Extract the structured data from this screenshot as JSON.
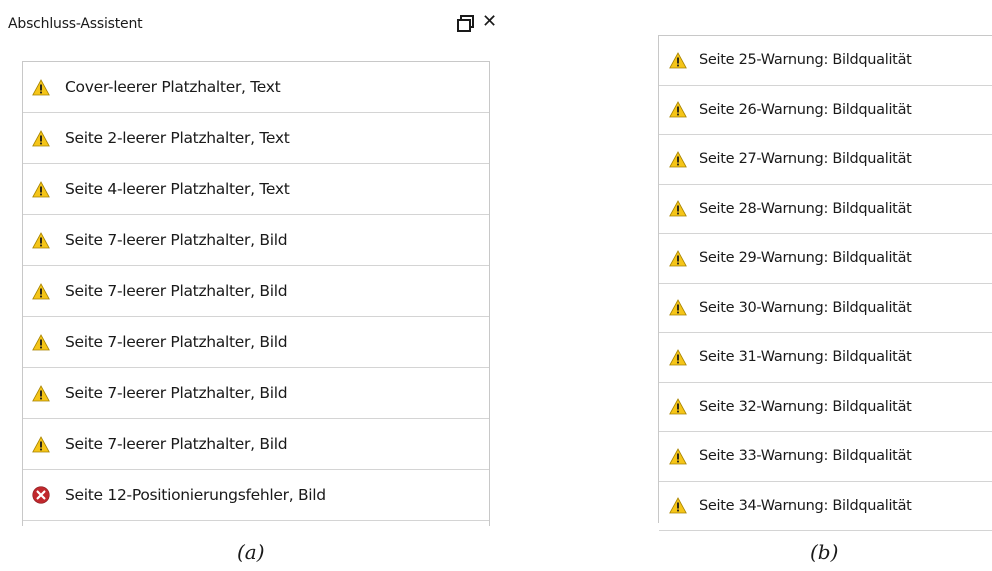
{
  "panel_a": {
    "title": "Abschluss-Assistent",
    "close_glyph": "✕",
    "items": [
      {
        "icon": "warning-icon",
        "label": "Cover-leerer Platzhalter, Text"
      },
      {
        "icon": "warning-icon",
        "label": "Seite 2-leerer Platzhalter, Text"
      },
      {
        "icon": "warning-icon",
        "label": "Seite 4-leerer Platzhalter, Text"
      },
      {
        "icon": "warning-icon",
        "label": "Seite 7-leerer Platzhalter, Bild"
      },
      {
        "icon": "warning-icon",
        "label": "Seite 7-leerer Platzhalter, Bild"
      },
      {
        "icon": "warning-icon",
        "label": "Seite 7-leerer Platzhalter, Bild"
      },
      {
        "icon": "warning-icon",
        "label": "Seite 7-leerer Platzhalter, Bild"
      },
      {
        "icon": "warning-icon",
        "label": "Seite 7-leerer Platzhalter, Bild"
      },
      {
        "icon": "error-icon",
        "label": "Seite 12-Positionierungsfehler, Bild"
      }
    ]
  },
  "panel_b": {
    "items": [
      {
        "icon": "warning-icon",
        "label": "Seite 25-Warnung: Bildqualität"
      },
      {
        "icon": "warning-icon",
        "label": "Seite 26-Warnung: Bildqualität"
      },
      {
        "icon": "warning-icon",
        "label": "Seite 27-Warnung: Bildqualität"
      },
      {
        "icon": "warning-icon",
        "label": "Seite 28-Warnung: Bildqualität"
      },
      {
        "icon": "warning-icon",
        "label": "Seite 29-Warnung: Bildqualität"
      },
      {
        "icon": "warning-icon",
        "label": "Seite 30-Warnung: Bildqualität"
      },
      {
        "icon": "warning-icon",
        "label": "Seite 31-Warnung: Bildqualität"
      },
      {
        "icon": "warning-icon",
        "label": "Seite 32-Warnung: Bildqualität"
      },
      {
        "icon": "warning-icon",
        "label": "Seite 33-Warnung: Bildqualität"
      },
      {
        "icon": "warning-icon",
        "label": "Seite 34-Warnung: Bildqualität"
      }
    ]
  },
  "captions": {
    "a": "(a)",
    "b": "(b)"
  },
  "colors": {
    "warning": "#f5c518",
    "error": "#c0282d",
    "border": "#d4d4d4"
  }
}
